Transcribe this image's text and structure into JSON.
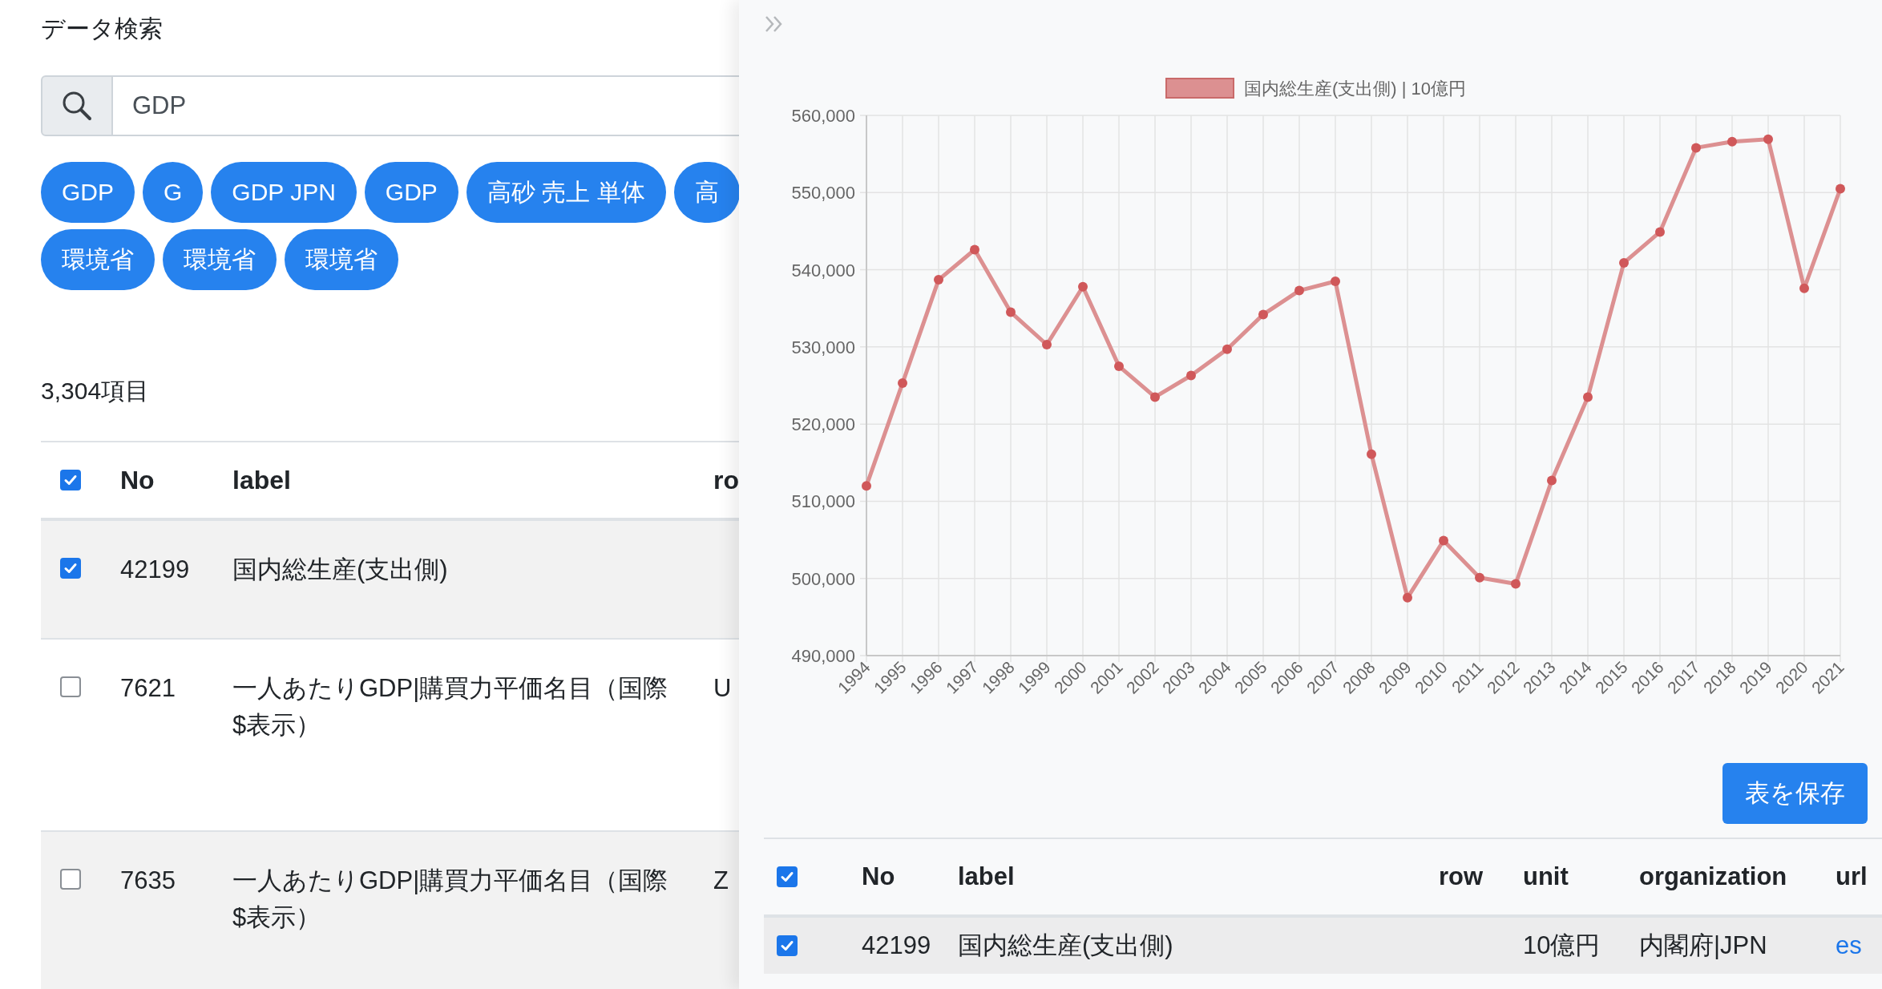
{
  "page": {
    "title": "データ検索"
  },
  "search": {
    "value": "GDP"
  },
  "chips": [
    "GDP",
    "G",
    "GDP JPN",
    "GDP",
    "高砂 売上 単体",
    "高",
    "環境省",
    "環境省",
    "環境省"
  ],
  "result_count": "3,304項目",
  "results_table": {
    "all_checked": true,
    "columns": [
      "No",
      "label",
      "ro"
    ],
    "rows": [
      {
        "checked": true,
        "no": "42199",
        "label": "国内総生産(支出側)"
      },
      {
        "checked": false,
        "no": "7621",
        "label": "一人あたりGDP|購買力平価名目（国際$表示）",
        "column_4": "U"
      },
      {
        "checked": false,
        "no": "7635",
        "label": "一人あたりGDP|購買力平価名目（国際$表示）",
        "column_4": "Z"
      }
    ]
  },
  "drawer": {
    "chart_data": {
      "type": "line",
      "categories": [
        "1994",
        "1995",
        "1996",
        "1997",
        "1998",
        "1999",
        "2000",
        "2001",
        "2002",
        "2003",
        "2004",
        "2005",
        "2006",
        "2007",
        "2008",
        "2009",
        "2010",
        "2011",
        "2012",
        "2013",
        "2014",
        "2015",
        "2016",
        "2017",
        "2018",
        "2019",
        "2020",
        "2021"
      ],
      "series": [
        {
          "name": "国内総生産(支出側) | 10億円",
          "color": "#dc9091",
          "values": [
            512000,
            525300,
            538700,
            542600,
            534500,
            530300,
            537800,
            527500,
            523500,
            526300,
            529700,
            534200,
            537300,
            538500,
            516100,
            497500,
            504900,
            500100,
            499300,
            512700,
            523500,
            540900,
            544900,
            555800,
            556600,
            556900,
            537600,
            550500
          ]
        }
      ],
      "ylim": [
        490000,
        560000
      ],
      "grid": true,
      "marker": true,
      "yticks": [
        {
          "value": 490000,
          "label": "490,000"
        },
        {
          "value": 500000,
          "label": "500,000"
        },
        {
          "value": 510000,
          "label": "510,000"
        },
        {
          "value": 520000,
          "label": "520,000"
        },
        {
          "value": 530000,
          "label": "530,000"
        },
        {
          "value": 540000,
          "label": "540,000"
        },
        {
          "value": 550000,
          "label": "550,000"
        },
        {
          "value": 560000,
          "label": "560,000"
        }
      ]
    },
    "save_button": "表を保存",
    "table": {
      "all_checked": true,
      "columns": [
        "No",
        "label",
        "row",
        "unit",
        "organization",
        "url"
      ],
      "rows": [
        {
          "checked": true,
          "no": "42199",
          "label": "国内総生産(支出側)",
          "unit": "10億円",
          "organization": "内閣府|JPN",
          "url": "es"
        }
      ]
    }
  }
}
